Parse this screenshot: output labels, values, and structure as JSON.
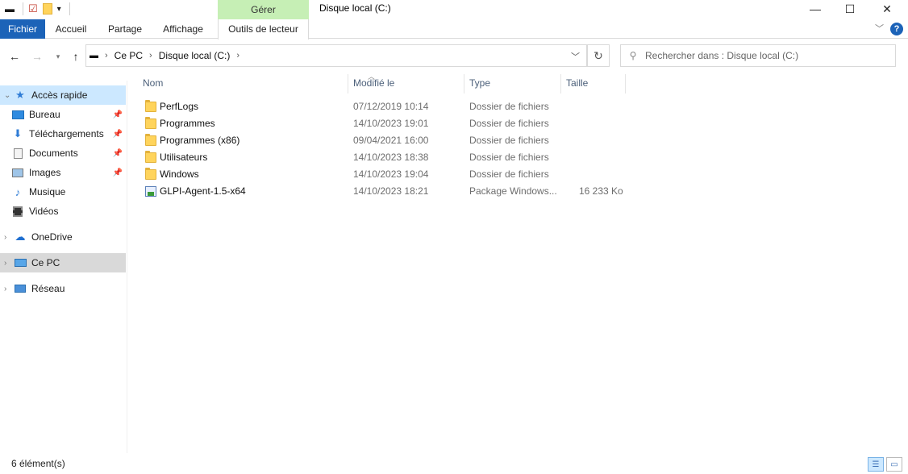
{
  "window": {
    "title": "Disque local (C:)",
    "contextual_tab": "Gérer",
    "minimize": "—",
    "maximize": "☐",
    "close": "✕"
  },
  "ribbon": {
    "tabs": [
      "Fichier",
      "Accueil",
      "Partage",
      "Affichage",
      "Outils de lecteur"
    ],
    "help": "?"
  },
  "address": {
    "segments": [
      "Ce PC",
      "Disque local (C:)"
    ]
  },
  "search": {
    "placeholder": "Rechercher dans : Disque local (C:)"
  },
  "sidebar": {
    "items": [
      {
        "label": "Accès rapide",
        "icon": "star-icon",
        "expanded": true
      },
      {
        "label": "Bureau",
        "icon": "desktop-icon",
        "pinned": true
      },
      {
        "label": "Téléchargements",
        "icon": "download-icon",
        "pinned": true
      },
      {
        "label": "Documents",
        "icon": "document-icon",
        "pinned": true
      },
      {
        "label": "Images",
        "icon": "image-icon",
        "pinned": true
      },
      {
        "label": "Musique",
        "icon": "music-icon"
      },
      {
        "label": "Vidéos",
        "icon": "video-icon"
      },
      {
        "label": "OneDrive",
        "icon": "cloud-icon"
      },
      {
        "label": "Ce PC",
        "icon": "computer-icon",
        "selected": true
      },
      {
        "label": "Réseau",
        "icon": "network-icon"
      }
    ]
  },
  "columns": {
    "name": "Nom",
    "modified": "Modifié le",
    "type": "Type",
    "size": "Taille"
  },
  "files": [
    {
      "name": "PerfLogs",
      "modified": "07/12/2019 10:14",
      "type": "Dossier de fichiers",
      "size": "",
      "kind": "folder"
    },
    {
      "name": "Programmes",
      "modified": "14/10/2023 19:01",
      "type": "Dossier de fichiers",
      "size": "",
      "kind": "folder"
    },
    {
      "name": "Programmes (x86)",
      "modified": "09/04/2021 16:00",
      "type": "Dossier de fichiers",
      "size": "",
      "kind": "folder"
    },
    {
      "name": "Utilisateurs",
      "modified": "14/10/2023 18:38",
      "type": "Dossier de fichiers",
      "size": "",
      "kind": "folder"
    },
    {
      "name": "Windows",
      "modified": "14/10/2023 19:04",
      "type": "Dossier de fichiers",
      "size": "",
      "kind": "folder"
    },
    {
      "name": "GLPI-Agent-1.5-x64",
      "modified": "14/10/2023 18:21",
      "type": "Package Windows...",
      "size": "16 233 Ko",
      "kind": "msi"
    }
  ],
  "status": {
    "count": "6 élément(s)"
  }
}
